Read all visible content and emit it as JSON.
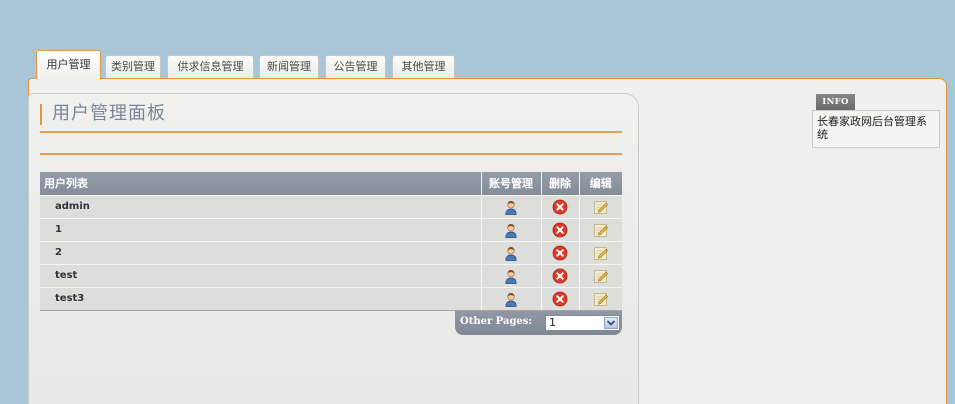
{
  "tabs": [
    {
      "label": "用户管理",
      "active": true
    },
    {
      "label": "类别管理",
      "active": false
    },
    {
      "label": "供求信息管理",
      "active": false
    },
    {
      "label": "新闻管理",
      "active": false
    },
    {
      "label": "公告管理",
      "active": false
    },
    {
      "label": "其他管理",
      "active": false
    }
  ],
  "panel": {
    "title": "用户管理面板"
  },
  "table": {
    "columns": {
      "list": "用户列表",
      "account": "账号管理",
      "delete": "删除",
      "edit": "编辑"
    },
    "rows": [
      {
        "name": "admin"
      },
      {
        "name": "1"
      },
      {
        "name": "2"
      },
      {
        "name": "test"
      },
      {
        "name": "test3"
      }
    ]
  },
  "pagination": {
    "label": "Other Pages:",
    "selected": "1"
  },
  "info": {
    "label": "INFO",
    "text": "长春家政网后台管理系统"
  },
  "icons": {
    "account": "user-icon",
    "delete": "delete-icon",
    "edit": "edit-icon",
    "dropdown": "chevron-down-icon"
  },
  "colors": {
    "accent": "#e6953f",
    "table_header": "#8a939f",
    "background": "#a9c6d9",
    "title_text": "#7b8794"
  }
}
